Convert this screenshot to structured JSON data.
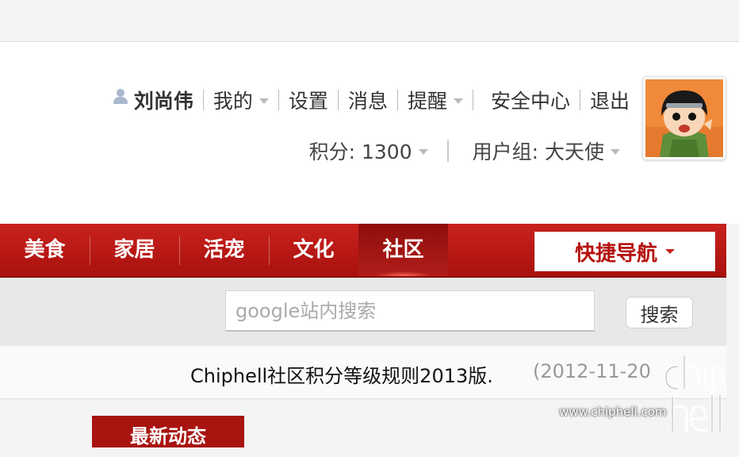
{
  "user": {
    "name": "刘尚伟",
    "menu": [
      "我的",
      "设置",
      "消息",
      "提醒",
      "安全中心",
      "退出"
    ],
    "points": "积分: 1300",
    "group": "用户组: 大天使"
  },
  "nav": {
    "items": [
      "美食",
      "家居",
      "活宠",
      "文化",
      "社区"
    ],
    "active": "社区",
    "quick_nav": "快捷导航"
  },
  "search": {
    "placeholder": "google站内搜索",
    "button": "搜索"
  },
  "announcement": {
    "text": "Chiphell社区积分等级规则2013版.",
    "date": "(2012-11-20"
  },
  "latest_tab": "最新动态",
  "watermark": {
    "logo": "chip hell",
    "url": "www.chiphell.com"
  },
  "colors": {
    "nav_red": "#b5120f",
    "nav_active": "#8e0e0c",
    "text_dark": "#333333",
    "caret_gray": "#bbbbbb"
  }
}
